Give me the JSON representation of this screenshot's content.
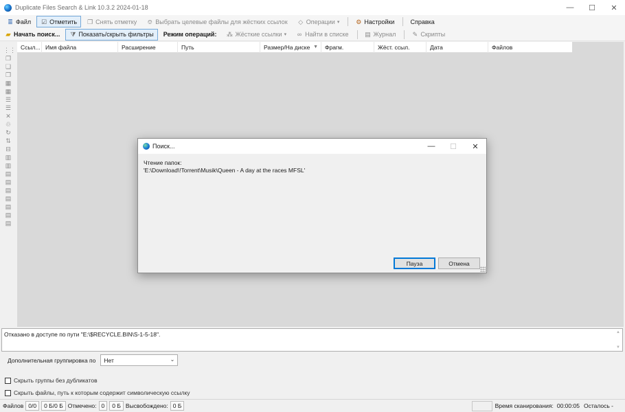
{
  "window": {
    "title": "Duplicate Files Search & Link 10.3.2 2024-01-18",
    "minimize": "—",
    "maximize": "☐",
    "close": "✕"
  },
  "menubar": {
    "file": "Файл",
    "mark": "Отметить",
    "unmark": "Снять отметку",
    "select_targets": "Выбрать целевые файлы для жёстких ссылок",
    "operations": "Операции",
    "settings": "Настройки",
    "help": "Справка"
  },
  "toolbar": {
    "start_search": "Начать поиск...",
    "toggle_filters": "Показать/скрыть фильтры",
    "mode_label": "Режим операций:",
    "hard_links": "Жёсткие ссылки",
    "find_in_list": "Найти в списке",
    "journal": "Журнал",
    "scripts": "Скрипты"
  },
  "grid": {
    "columns": [
      "Ссыл...",
      "Имя файла",
      "Расширение",
      "Путь",
      "Размер/На диске",
      "Фрагм.",
      "Жёст. ссыл.",
      "Дата",
      "Файлов"
    ]
  },
  "log": {
    "message": "Отказано в доступе по пути \"E:\\$RECYCLE.BIN\\S-1-5-18\"."
  },
  "grouping": {
    "label": "Дополнительная группировка по",
    "selected": "Нет"
  },
  "options": {
    "hide_groups": "Скрыть группы без дубликатов",
    "hide_symlinks": "Скрыть файлы, путь к которым содержит символическую ссылку"
  },
  "status": {
    "files_label": "Файлов",
    "files_count": "0/0",
    "files_size": "0 Б/0 Б",
    "marked_label": "Отмечено:",
    "marked_count": "0",
    "marked_size": "0 Б",
    "freed_label": "Высвобождено:",
    "freed_value": "0 Б",
    "scan_time_label": "Время сканирования:",
    "scan_time": "00:00:05",
    "remaining_label": "Осталось -"
  },
  "dialog": {
    "title": "Поиск...",
    "line1": "Чтение папок:",
    "line2": "'E:\\Download\\!Torrent\\Musik\\Queen - A day at the races MFSL'",
    "pause": "Пауза",
    "cancel": "Отмена"
  },
  "colors": {
    "accent": "#0078d7",
    "grid_bg": "#d9d9d9"
  }
}
